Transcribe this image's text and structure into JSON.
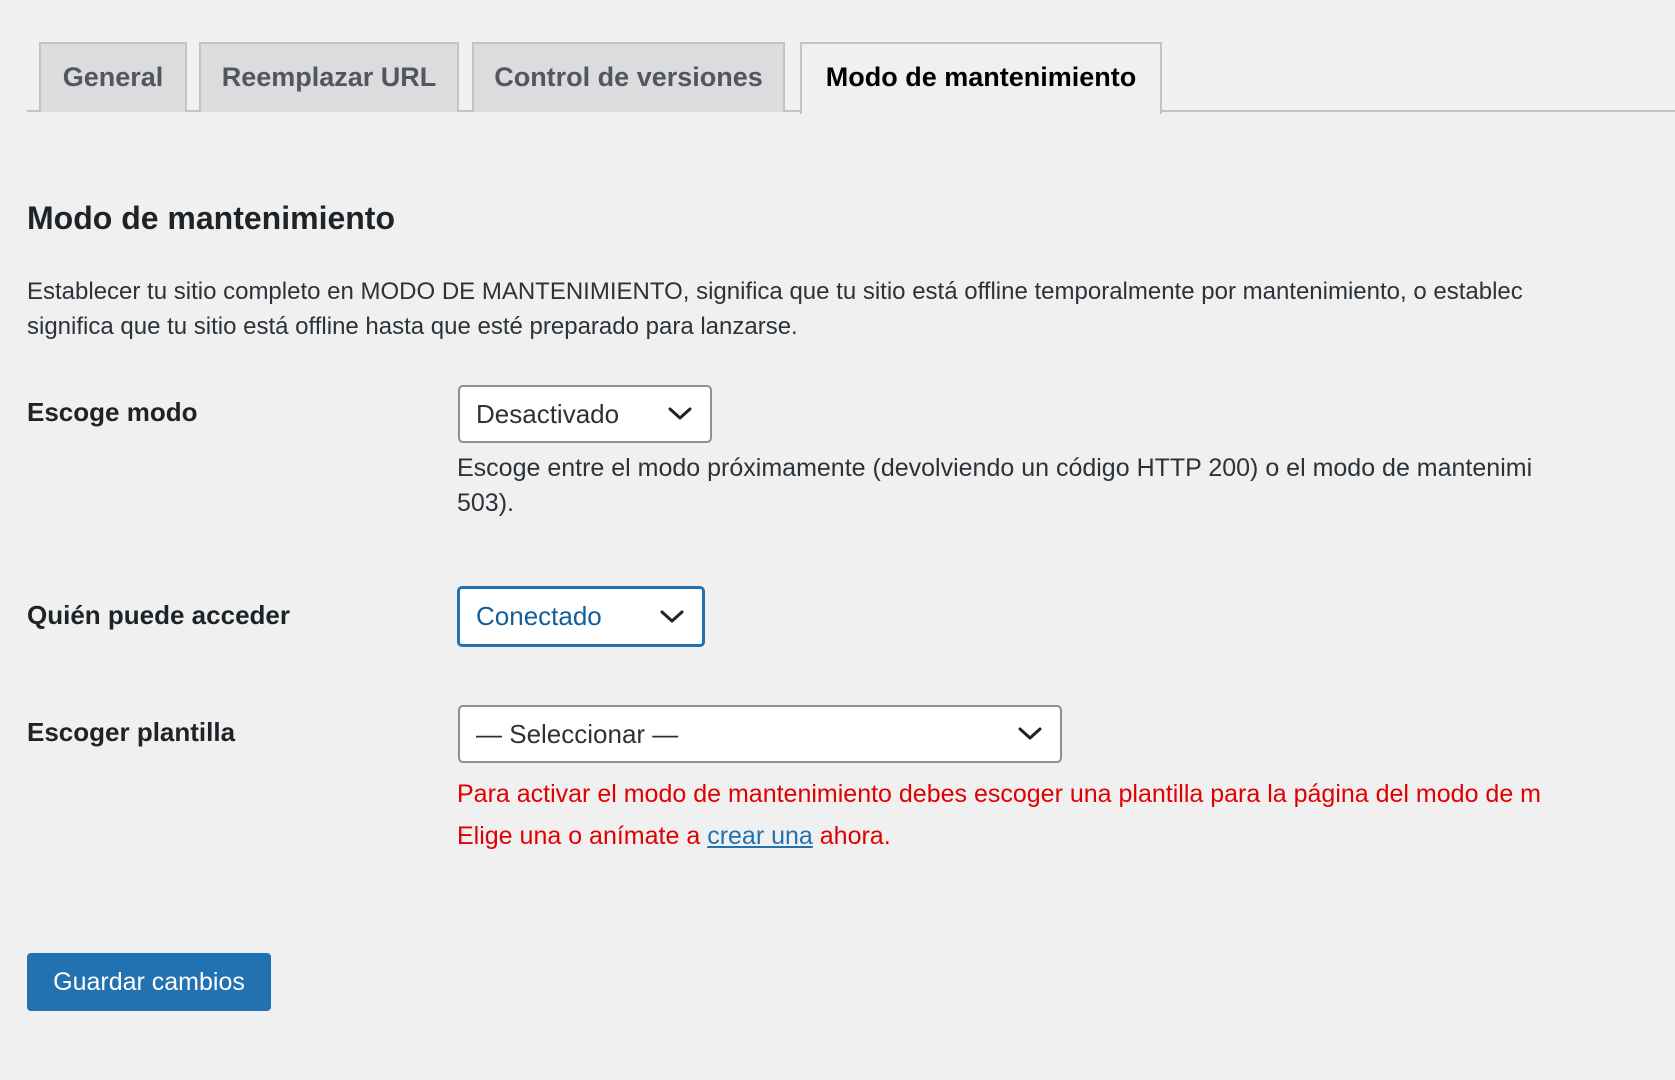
{
  "tabs": [
    {
      "label": "General",
      "active": false
    },
    {
      "label": "Reemplazar URL",
      "active": false
    },
    {
      "label": "Control de versiones",
      "active": false
    },
    {
      "label": "Modo de mantenimiento",
      "active": true
    }
  ],
  "section": {
    "title": "Modo de mantenimiento",
    "description_line1": "Establecer tu sitio completo en MODO DE MANTENIMIENTO, significa que tu sitio está offline temporalmente por mantenimiento, o establec",
    "description_line2": "significa que tu sitio está offline hasta que esté preparado para lanzarse."
  },
  "fields": {
    "mode": {
      "label": "Escoge modo",
      "value": "Desactivado",
      "help_line1": "Escoge entre el modo próximamente (devolviendo un código HTTP 200) o el modo de mantenimi",
      "help_line2": "503)."
    },
    "access": {
      "label": "Quién puede acceder",
      "value": "Conectado"
    },
    "template": {
      "label": "Escoger plantilla",
      "value": "— Seleccionar —",
      "error_line1": "Para activar el modo de mantenimiento debes escoger una plantilla para la página del modo de m",
      "error_line2_before": "Elige una o anímate a",
      "error_link": "crear una",
      "error_line2_after": "ahora."
    }
  },
  "actions": {
    "save_label": "Guardar cambios"
  },
  "colors": {
    "accent": "#2271b1",
    "error": "#e00000",
    "background": "#f0f0f1"
  }
}
